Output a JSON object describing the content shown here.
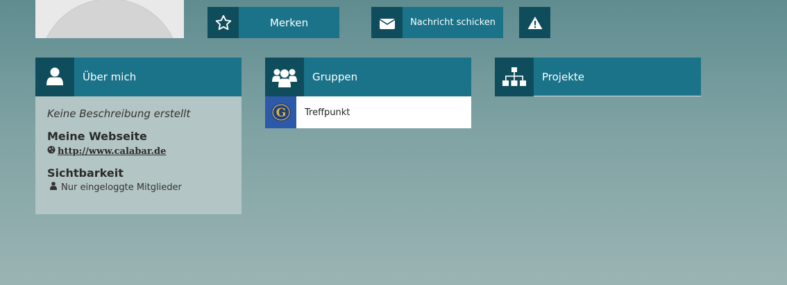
{
  "actions": {
    "merken_label": "Merken",
    "nachricht_label": "Nachricht schicken"
  },
  "about": {
    "title": "Über mich",
    "description": "Keine Beschreibung erstellt",
    "website_heading": "Meine Webseite",
    "website_url": "http://www.calabar.de",
    "visibility_heading": "Sichtbarkeit",
    "visibility_value": "Nur eingeloggte Mitglieder"
  },
  "groups": {
    "title": "Gruppen",
    "items": [
      {
        "name": "Treffpunkt",
        "logo_letter": "G"
      }
    ]
  },
  "projects": {
    "title": "Projekte"
  },
  "colors": {
    "header": "#1a7389",
    "icon_box": "#0f4d5c",
    "about_body": "#b3c5c4"
  },
  "icons": {
    "merken": "star-icon",
    "nachricht": "envelope-icon",
    "report": "warning-icon",
    "about": "user-icon",
    "groups": "users-icon",
    "projects": "sitemap-icon",
    "website": "globe-icon",
    "visibility": "user-small-icon"
  }
}
